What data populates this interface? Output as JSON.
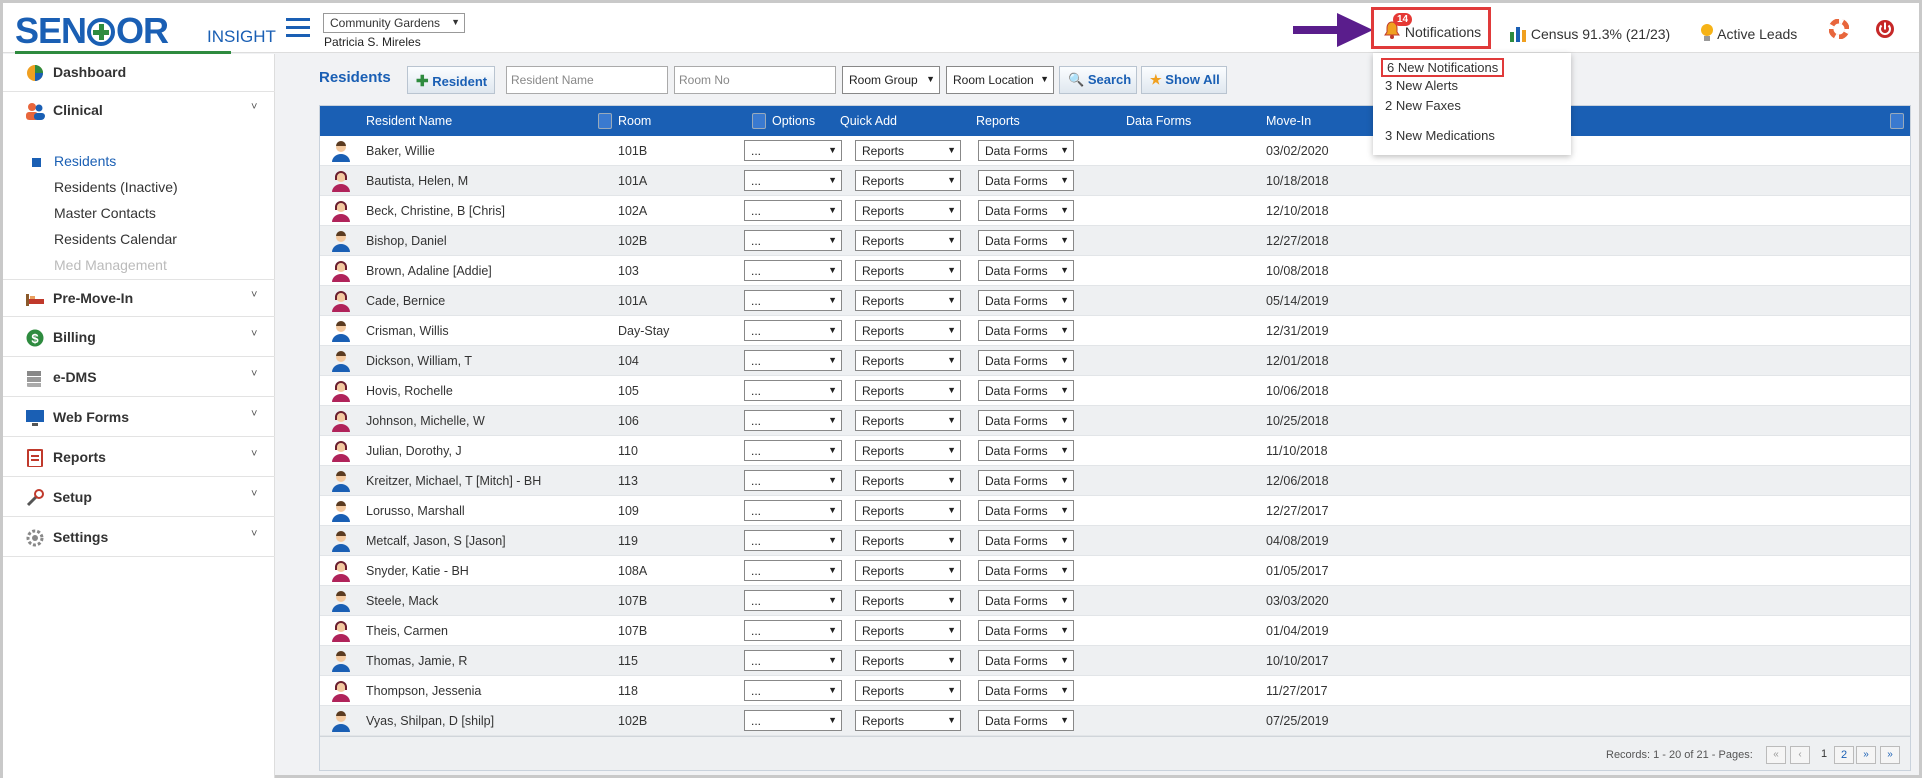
{
  "app": {
    "logo_main": "SENIOR",
    "logo_sub": "INSIGHT"
  },
  "header": {
    "community": "Community Gardens",
    "user": "Patricia S. Mireles",
    "notifications_label": "Notifications",
    "notifications_count": "14",
    "census_label": "Census 91.3% (21/23)",
    "leads_label": "Active Leads"
  },
  "notif_menu": {
    "notifications": "6 New Notifications",
    "alerts": "3 New Alerts",
    "faxes": "2 New Faxes",
    "medications": "3 New Medications"
  },
  "sidebar": {
    "dashboard": "Dashboard",
    "clinical": "Clinical",
    "clinical_items": [
      "Residents",
      "Residents (Inactive)",
      "Master Contacts",
      "Residents Calendar",
      "Med Management"
    ],
    "premovein": "Pre-Move-In",
    "billing": "Billing",
    "edms": "e-DMS",
    "webforms": "Web Forms",
    "reports": "Reports",
    "setup": "Setup",
    "settings": "Settings"
  },
  "toolbar": {
    "title": "Residents",
    "add_resident": "Resident",
    "name_placeholder": "Resident Name",
    "room_placeholder": "Room No",
    "room_group": "Room Group",
    "room_location": "Room Location",
    "search": "Search",
    "show_all": "Show All"
  },
  "grid": {
    "columns": [
      "Resident Name",
      "Room",
      "Options",
      "Quick Add",
      "Reports",
      "Data Forms",
      "Move-In"
    ],
    "quick_add_value": "...",
    "reports_value": "Reports",
    "dataforms_value": "Data Forms",
    "rows": [
      {
        "name": "Baker, Willie",
        "room": "101B",
        "movein": "03/02/2020",
        "g": "m"
      },
      {
        "name": "Bautista, Helen, M",
        "room": "101A",
        "movein": "10/18/2018",
        "g": "f"
      },
      {
        "name": "Beck, Christine, B [Chris]",
        "room": "102A",
        "movein": "12/10/2018",
        "g": "f"
      },
      {
        "name": "Bishop, Daniel",
        "room": "102B",
        "movein": "12/27/2018",
        "g": "m"
      },
      {
        "name": "Brown, Adaline [Addie]",
        "room": "103",
        "movein": "10/08/2018",
        "g": "f"
      },
      {
        "name": "Cade, Bernice",
        "room": "101A",
        "movein": "05/14/2019",
        "g": "f"
      },
      {
        "name": "Crisman, Willis",
        "room": "Day-Stay",
        "movein": "12/31/2019",
        "g": "m"
      },
      {
        "name": "Dickson, William, T",
        "room": "104",
        "movein": "12/01/2018",
        "g": "m"
      },
      {
        "name": "Hovis, Rochelle",
        "room": "105",
        "movein": "10/06/2018",
        "g": "f"
      },
      {
        "name": "Johnson, Michelle, W",
        "room": "106",
        "movein": "10/25/2018",
        "g": "f"
      },
      {
        "name": "Julian, Dorothy, J",
        "room": "110",
        "movein": "11/10/2018",
        "g": "f"
      },
      {
        "name": "Kreitzer, Michael, T [Mitch] - BH",
        "room": "113",
        "movein": "12/06/2018",
        "g": "m"
      },
      {
        "name": "Lorusso, Marshall",
        "room": "109",
        "movein": "12/27/2017",
        "g": "m"
      },
      {
        "name": "Metcalf, Jason, S [Jason]",
        "room": "119",
        "movein": "04/08/2019",
        "g": "m"
      },
      {
        "name": "Snyder, Katie - BH",
        "room": "108A",
        "movein": "01/05/2017",
        "g": "f"
      },
      {
        "name": "Steele, Mack",
        "room": "107B",
        "movein": "03/03/2020",
        "g": "m"
      },
      {
        "name": "Theis, Carmen",
        "room": "107B",
        "movein": "01/04/2019",
        "g": "f"
      },
      {
        "name": "Thomas, Jamie, R",
        "room": "115",
        "movein": "10/10/2017",
        "g": "m"
      },
      {
        "name": "Thompson, Jessenia",
        "room": "118",
        "movein": "11/27/2017",
        "g": "f"
      },
      {
        "name": "Vyas, Shilpan, D [shilp]",
        "room": "102B",
        "movein": "07/25/2019",
        "g": "m"
      }
    ],
    "records_text": "Records: 1 - 20 of 21 - Pages:",
    "pages": [
      "1",
      "2"
    ]
  }
}
